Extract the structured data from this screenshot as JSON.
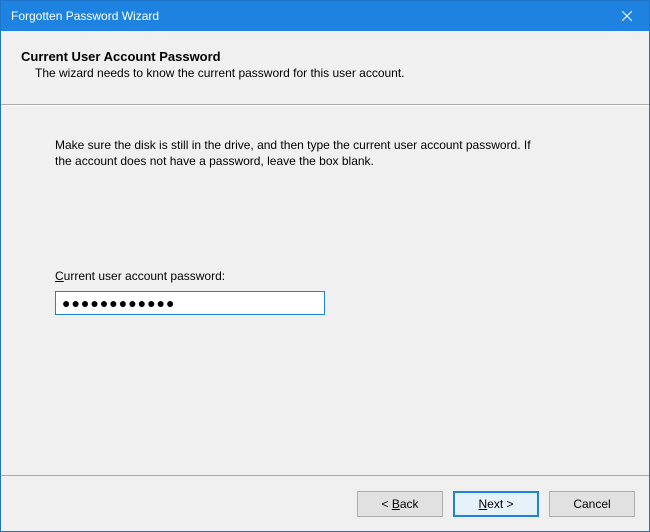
{
  "window": {
    "title": "Forgotten Password Wizard"
  },
  "header": {
    "title": "Current User Account Password",
    "subtitle": "The wizard needs to know the current password for this user account."
  },
  "content": {
    "instruction": "Make sure the disk is still in the drive, and then type the current user account password. If the account does not have a password, leave the box blank.",
    "field_label_pre": "C",
    "field_label_rest": "urrent user account password:",
    "password_value": "●●●●●●●●●●●●"
  },
  "footer": {
    "back_pre": "< ",
    "back_ul": "B",
    "back_rest": "ack",
    "next_ul": "N",
    "next_rest": "ext >",
    "cancel": "Cancel"
  }
}
